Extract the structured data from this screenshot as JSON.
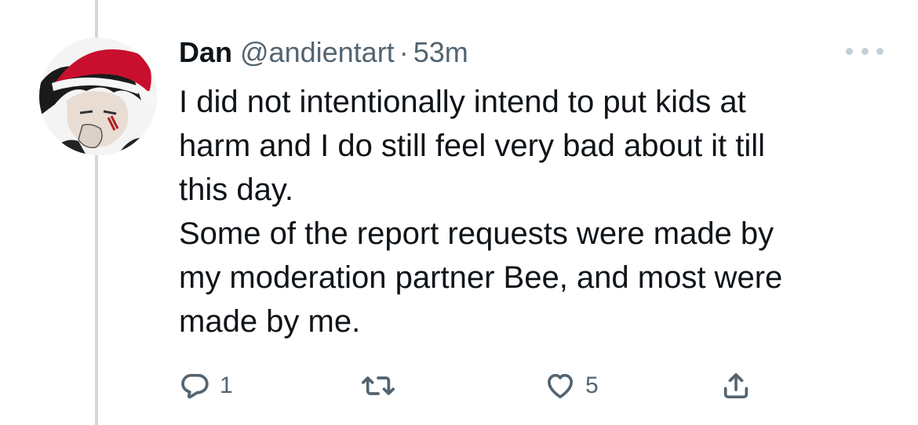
{
  "tweet": {
    "display_name": "Dan",
    "handle": "@andientart",
    "separator": "·",
    "time": "53m",
    "lines": [
      "I did not intentionally intend to put kids at",
      "harm and I do still feel very bad about it till",
      "this day.",
      "Some of the report requests were made by",
      "my moderation partner Bee, and most were",
      "made by me."
    ]
  },
  "actions": {
    "reply_count": "1",
    "retweet_count": "",
    "like_count": "5"
  },
  "icons": {
    "reply": "reply-bubble-icon",
    "retweet": "retweet-arrows-icon",
    "like": "heart-icon",
    "share": "share-upload-icon",
    "more": "more-dots-icon"
  },
  "colors": {
    "text_primary": "#0f1419",
    "text_secondary": "#536471",
    "thread_line": "#cfd9de",
    "santa_hat": "#c8102e"
  }
}
